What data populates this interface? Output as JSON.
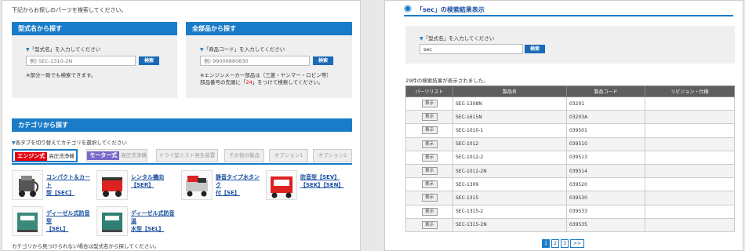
{
  "left": {
    "intro": "下記からお探しのパーツを検索してください。",
    "model_search": {
      "title": "型式名から探す",
      "hint": "「型式名」を入力してください",
      "placeholder": "例) SEC-1310-2N",
      "button": "検索",
      "note": "※部分一致でも検索できます。"
    },
    "part_search": {
      "title": "全部品から探す",
      "hint": "「商品コード」を入力してください",
      "placeholder": "例) 99000880830",
      "button": "検索",
      "note_line1": "※エンジンメーカー部品は（三菱・ヤンマー・ロビン等）",
      "note_line2_a": "部品番号の先頭に「",
      "note_line2_red": "24",
      "note_line2_b": "」をつけて検索してください。"
    },
    "category": {
      "title": "カテゴリから探す",
      "hint": "各タブを切り替えてカテゴリを選択してください",
      "tabs": [
        {
          "badge": "エンジン式",
          "label": "高圧洗浄機"
        },
        {
          "badge": "モーター式",
          "label": "高圧洗浄機"
        },
        {
          "label": "ドライ型ミスト発生装置"
        },
        {
          "label": "その他の製品"
        },
        {
          "label": "オプション1"
        },
        {
          "label": "オプション2"
        }
      ],
      "items": [
        {
          "line1": "コンパクト＆カート",
          "line2": "型【SEC】"
        },
        {
          "line1": "レンタル機向",
          "line2": "【SER】"
        },
        {
          "line1": "静音タイプ水タンク",
          "line2": "付【SE】"
        },
        {
          "line1": "防音型【SEV】",
          "line2": "【SEK】【SEN】"
        },
        {
          "line1": "ディーゼル式防音型",
          "line2": "【SEL】"
        },
        {
          "line1": "ディーゼル式防音温",
          "line2": "水型【SEL】"
        }
      ],
      "footnote": "カテゴリから見つけられない場合は型式名から探してください。"
    }
  },
  "right": {
    "heading": "「sec」の検索結果表示",
    "hint": "「型式名」を入力してください",
    "search_value": "sec",
    "button": "検索",
    "count_text": "29件の検索結果が表示されました。",
    "columns": [
      "パーツリスト",
      "製品名",
      "製品コード",
      "リビジョン・仕様"
    ],
    "show_label": "表示",
    "rows": [
      {
        "name": "SEC-1308N",
        "code": "03201",
        "rev": ""
      },
      {
        "name": "SEC-1615N",
        "code": "03203A",
        "rev": ""
      },
      {
        "name": "SEC-1010-1",
        "code": "039501",
        "rev": ""
      },
      {
        "name": "SEC-1012",
        "code": "039510",
        "rev": ""
      },
      {
        "name": "SEC-1012-2",
        "code": "039513",
        "rev": ""
      },
      {
        "name": "SEC-1012-2N",
        "code": "039514",
        "rev": ""
      },
      {
        "name": "SEC-1309",
        "code": "039520",
        "rev": ""
      },
      {
        "name": "SEC-1315",
        "code": "039530",
        "rev": ""
      },
      {
        "name": "SEC-1315-2",
        "code": "039533",
        "rev": ""
      },
      {
        "name": "SEC-1315-2N",
        "code": "039535",
        "rev": ""
      }
    ],
    "pager": [
      "1",
      "2",
      "3",
      ">>"
    ]
  },
  "colors": {
    "accent": "#1a7cc8",
    "engine_badge": "#e60012",
    "motor_badge": "#7a68c8"
  }
}
